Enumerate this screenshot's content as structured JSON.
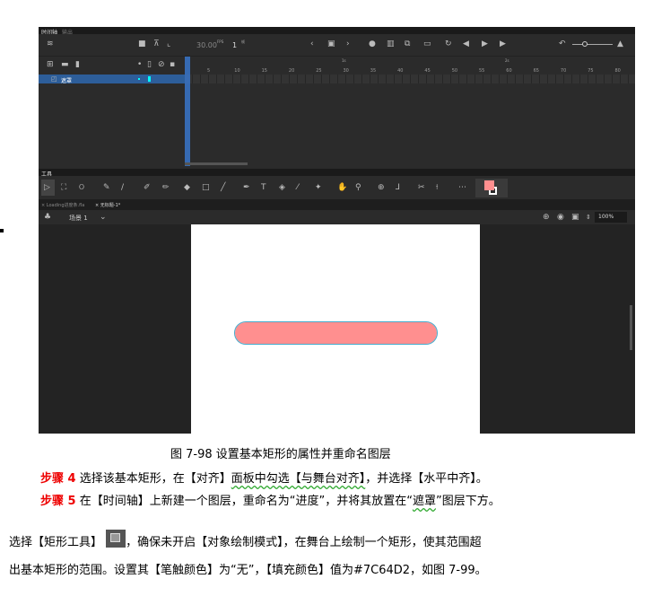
{
  "timeline": {
    "tabs": [
      "时间轴",
      "输出"
    ],
    "fps": "30.00",
    "fps_unit": "FPS",
    "frame": "1",
    "frame_unit": "帧",
    "ruler_seconds": [
      "1s",
      "2s"
    ],
    "ruler_ticks": [
      "5",
      "10",
      "15",
      "20",
      "25",
      "30",
      "35",
      "40",
      "45",
      "50",
      "55",
      "60",
      "65",
      "70",
      "75",
      "80"
    ],
    "layer_name": "遮罩"
  },
  "tools": {
    "title": "工具",
    "fill_color": "#ff8f8f"
  },
  "doc_tabs": [
    "Loading进度条.fla",
    "无标题-1*"
  ],
  "scene": {
    "label": "场景 1",
    "zoom": "100%"
  },
  "stage": {
    "shape_color": "#ff8f8f"
  },
  "caption": "图  7-98  设置基本矩形的属性并重命名图层",
  "steps": [
    {
      "label": "步骤 4",
      "parts": [
        "选择该基本矩形，在【对齐】",
        "面板中勾选【与舞台对齐】",
        "，并选择【水平中齐】。"
      ]
    },
    {
      "label": "步骤 5",
      "parts": [
        "在【时间轴】上新建一个图层，重命名为“进度”，并将其放置在“",
        "遮罩",
        "”图层下方。"
      ]
    }
  ],
  "para": {
    "line1a": "选择【矩形工具】",
    "line1b": "，确保未开启【对象绘制模式】，在舞台上绘制一个矩形，使其范围超",
    "line2": "出基本矩形的范围。设置其【笔触颜色】为“无”，【填充颜色】值为#7C64D2，如图 7-99。"
  }
}
